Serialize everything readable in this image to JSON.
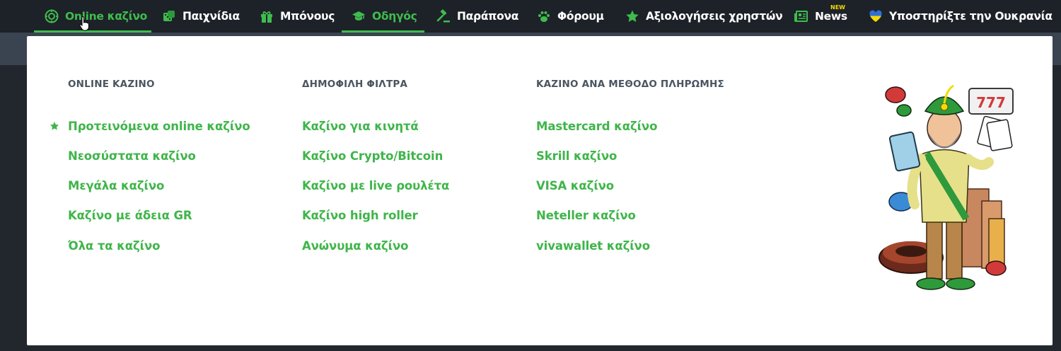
{
  "nav": {
    "items": [
      {
        "label": "Online καζίνο",
        "icon": "casino-chip-icon",
        "active": true
      },
      {
        "label": "Παιχνίδια",
        "icon": "dice-icon",
        "active": false
      },
      {
        "label": "Μπόνους",
        "icon": "gift-icon",
        "active": false
      },
      {
        "label": "Οδηγός",
        "icon": "graduation-cap-icon",
        "active": true
      },
      {
        "label": "Παράπονα",
        "icon": "gavel-icon",
        "active": false
      },
      {
        "label": "Φόρουμ",
        "icon": "paw-icon",
        "active": false
      },
      {
        "label": "Αξιολογήσεις χρηστών",
        "icon": "star-icon",
        "active": false
      },
      {
        "label": "News",
        "icon": "newspaper-icon",
        "badge": "NEW",
        "active": false
      },
      {
        "label": "Υποστηρίξτε την Ουκρανία",
        "icon": "ukraine-heart-icon",
        "active": false
      }
    ]
  },
  "dropdown": {
    "columns": [
      {
        "title": "ONLINE ΚΑΖΙΝΟ",
        "links": [
          "Προτεινόμενα online καζίνο",
          "Νεοσύστατα καζίνο",
          "Μεγάλα καζίνο",
          "Καζίνο με άδεια GR",
          "Όλα τα καζίνο"
        ]
      },
      {
        "title": "ΔΗΜΟΦΙΛΗ ΦΙΛΤΡΑ",
        "links": [
          "Καζίνο για κινητά",
          "Καζίνο Crypto/Bitcoin",
          "Καζίνο με live ρουλέτα",
          "Καζίνο high roller",
          "Ανώνυμα καζίνο"
        ]
      },
      {
        "title": "ΚΑΖΙΝΟ ΑΝΑ ΜΕΘΟΔΟ ΠΛΗΡΩΜΗΣ",
        "links": [
          "Mastercard καζίνο",
          "Skrill καζίνο",
          "VISA καζίνο",
          "Neteller καζίνο",
          "vivawallet καζίνο"
        ]
      }
    ]
  },
  "colors": {
    "accent": "#3fbc4e",
    "nav_bg": "#1d2228",
    "badge": "#f5d90a"
  }
}
